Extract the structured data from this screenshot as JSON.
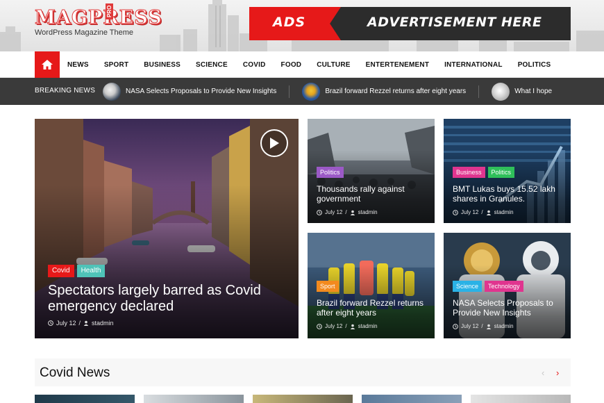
{
  "header": {
    "logo_text": "MAGPRESS",
    "logo_badge": "PRO",
    "tagline": "WordPress Magazine Theme",
    "ad": {
      "left_text": "ADS",
      "right_text": "ADVERTISEMENT HERE"
    }
  },
  "nav": {
    "home_icon": "home-icon",
    "items": [
      "NEWS",
      "SPORT",
      "BUSINESS",
      "SCIENCE",
      "COVID",
      "FOOD",
      "CULTURE",
      "ENTERTENEMENT",
      "INTERNATIONAL",
      "POLITICS"
    ]
  },
  "breaking": {
    "label": "BREAKING NEWS",
    "items": [
      "NASA Selects Proposals to Provide New Insights",
      "Brazil forward Rezzel returns after eight years",
      "What I hope"
    ]
  },
  "featured": {
    "main": {
      "tags": [
        {
          "label": "Covid",
          "color": "#e61919"
        },
        {
          "label": "Health",
          "color": "#4fc3b8"
        }
      ],
      "title": "Spectators largely barred as Covid emergency declared",
      "date": "July 12",
      "author": "stadmin"
    },
    "cards": [
      {
        "tags": [
          {
            "label": "Politics",
            "color": "#9b59c6"
          }
        ],
        "title": "Thousands rally against government",
        "date": "July 12",
        "author": "stadmin"
      },
      {
        "tags": [
          {
            "label": "Business",
            "color": "#e0358f"
          },
          {
            "label": "Politics",
            "color": "#2fbf5a"
          }
        ],
        "title": "BMT Lukas buys 15.52 lakh shares in Granules.",
        "date": "July 12",
        "author": "stadmin"
      },
      {
        "tags": [
          {
            "label": "Sport",
            "color": "#f28a1e"
          }
        ],
        "title": "Brazil forward Rezzel returns after eight years",
        "date": "July 12",
        "author": "stadmin"
      },
      {
        "tags": [
          {
            "label": "Science",
            "color": "#2ab2e6"
          },
          {
            "label": "Technology",
            "color": "#e0358f"
          }
        ],
        "title": "NASA Selects Proposals to Provide New Insights",
        "date": "July 12",
        "author": "stadmin"
      }
    ]
  },
  "section": {
    "title": "Covid News",
    "prev_icon": "chevron-left-icon",
    "next_icon": "chevron-right-icon"
  },
  "colors": {
    "accent": "#e61919",
    "dark_bar": "#3a3a3a"
  }
}
